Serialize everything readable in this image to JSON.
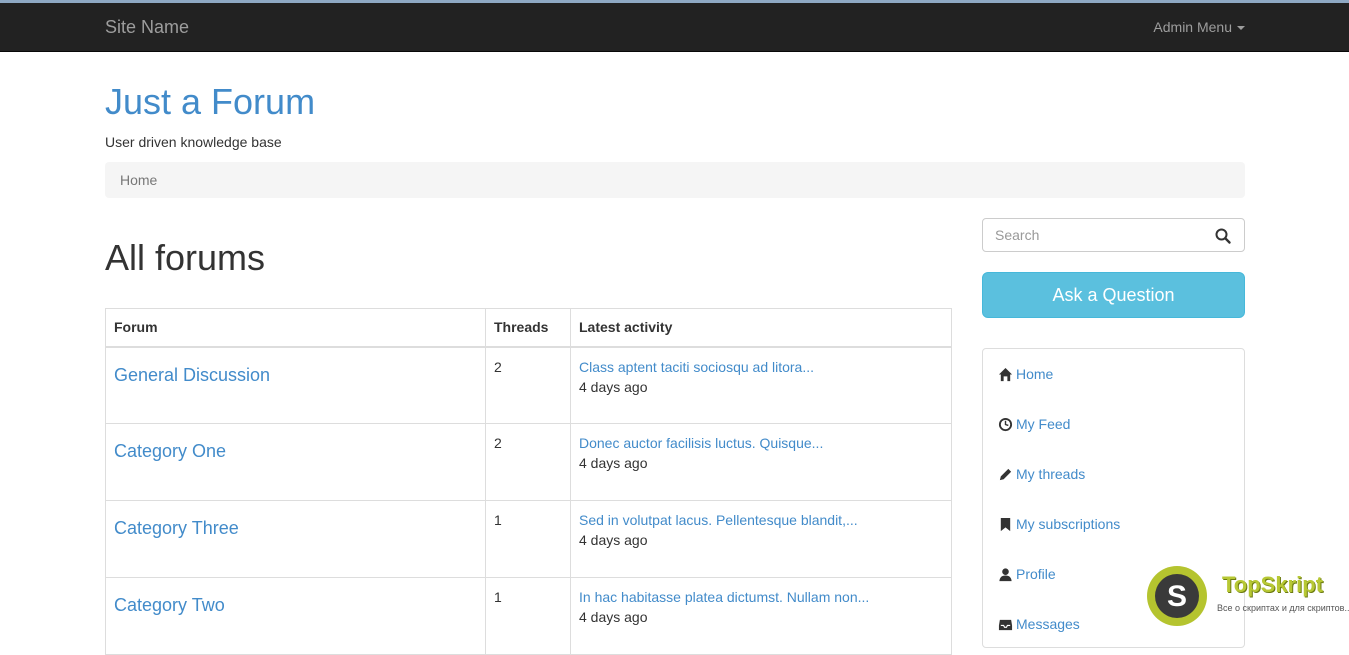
{
  "navbar": {
    "brand": "Site Name",
    "admin_menu": "Admin Menu"
  },
  "header": {
    "title": "Just a Forum",
    "tagline": "User driven knowledge base"
  },
  "breadcrumb": {
    "items": [
      "Home"
    ]
  },
  "main": {
    "heading": "All forums",
    "table": {
      "columns": [
        "Forum",
        "Threads",
        "Latest activity"
      ],
      "rows": [
        {
          "forum": "General Discussion",
          "threads": "2",
          "latest": "Class aptent taciti sociosqu ad litora...",
          "time": "4 days ago"
        },
        {
          "forum": "Category One",
          "threads": "2",
          "latest": "Donec auctor facilisis luctus. Quisque...",
          "time": "4 days ago"
        },
        {
          "forum": "Category Three",
          "threads": "1",
          "latest": "Sed in volutpat lacus. Pellentesque blandit,...",
          "time": "4 days ago"
        },
        {
          "forum": "Category Two",
          "threads": "1",
          "latest": "In hac habitasse platea dictumst. Nullam non...",
          "time": "4 days ago"
        }
      ]
    }
  },
  "sidebar": {
    "search_placeholder": "Search",
    "ask_button": "Ask a Question",
    "menu": [
      {
        "label": "Home",
        "icon": "home-icon"
      },
      {
        "label": "My Feed",
        "icon": "clock-icon"
      },
      {
        "label": "My threads",
        "icon": "pencil-icon"
      },
      {
        "label": "My subscriptions",
        "icon": "bookmark-icon"
      },
      {
        "label": "Profile",
        "icon": "user-icon"
      },
      {
        "label": "Messages",
        "icon": "inbox-icon"
      }
    ]
  },
  "watermark": {
    "name": "TopSkript",
    "tagline": "Все о скриптах и для скриптов...",
    "logo_letter": "S"
  },
  "colors": {
    "link": "#428bca",
    "navbar_bg": "#222222",
    "ask_button_bg": "#5bc0de",
    "breadcrumb_bg": "#f5f5f5"
  }
}
